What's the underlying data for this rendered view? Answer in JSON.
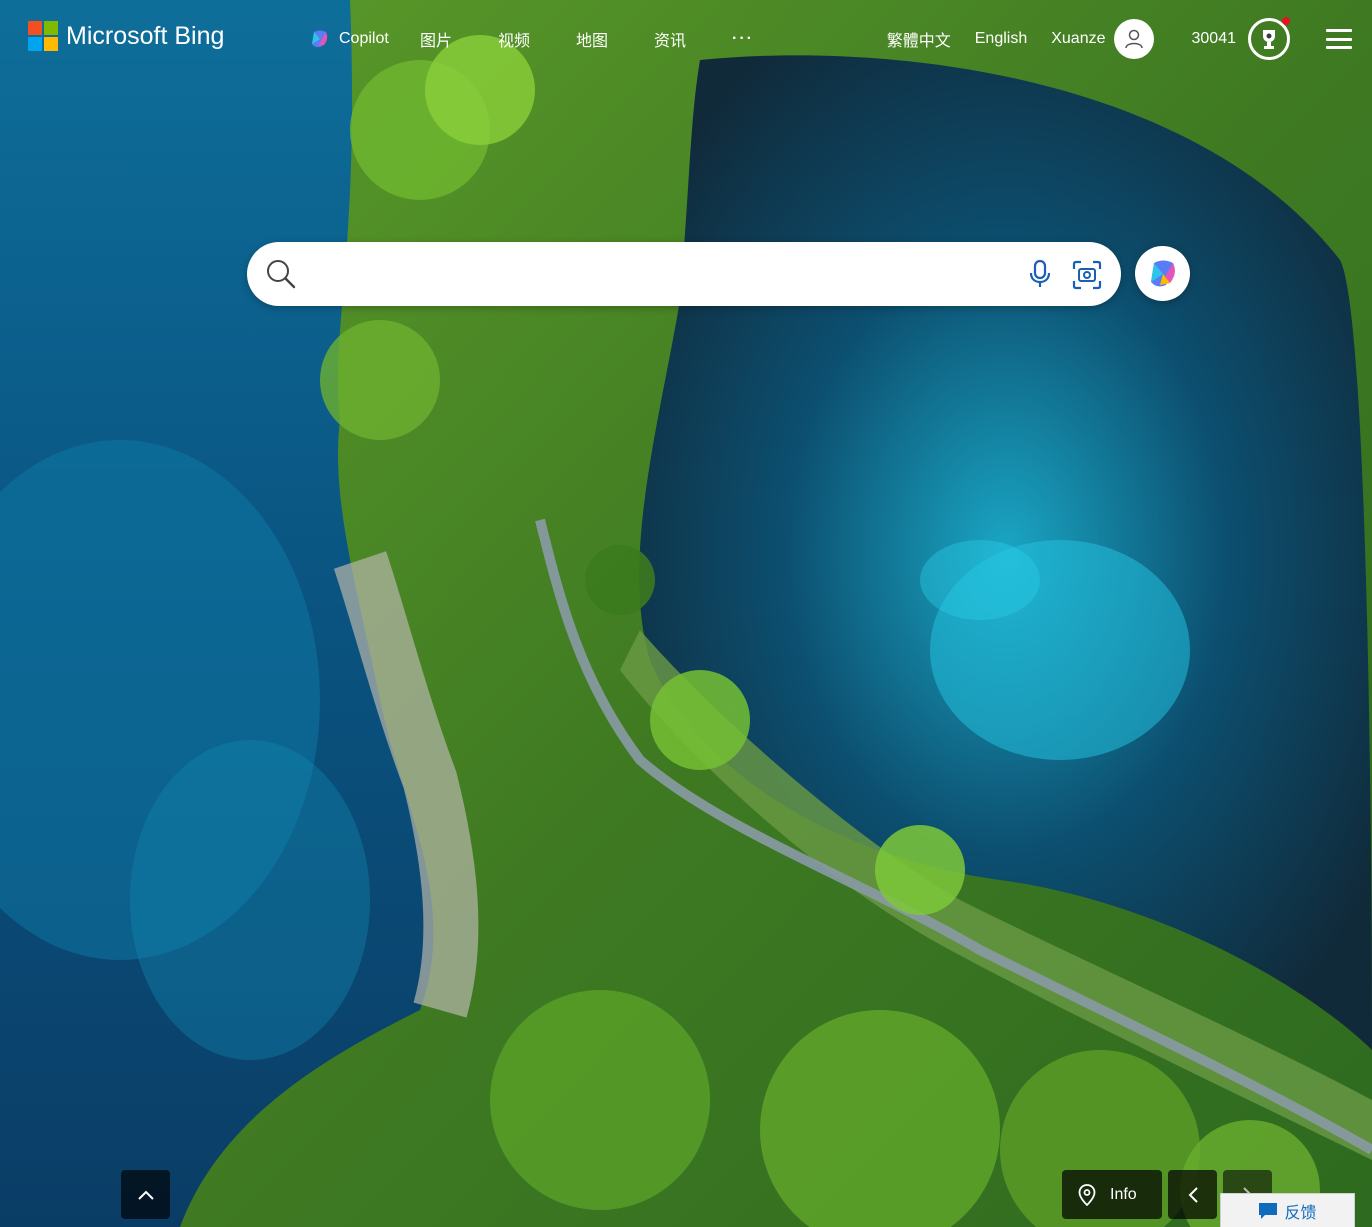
{
  "brand": {
    "name": "Microsoft Bing",
    "logo_colors": [
      "#f25022",
      "#7fba00",
      "#00a4ef",
      "#ffb900"
    ]
  },
  "nav": {
    "copilot": "Copilot",
    "images": "图片",
    "videos": "视频",
    "maps": "地图",
    "news": "资讯",
    "more": "···"
  },
  "header_right": {
    "language_traditional": "繁體中文",
    "language_english": "English",
    "username": "Xuanze",
    "reward_points": "30041"
  },
  "search": {
    "placeholder": "",
    "value": ""
  },
  "footer": {
    "info_label": "Info",
    "feedback_label": "反馈"
  },
  "icons": {
    "search": "search-icon",
    "mic": "microphone-icon",
    "visual_search": "visual-search-icon",
    "copilot": "copilot-icon",
    "avatar": "user-avatar-icon",
    "rewards": "rewards-trophy-icon",
    "menu": "hamburger-menu-icon",
    "location": "location-pin-icon",
    "up": "chevron-up-icon",
    "left": "chevron-left-icon",
    "right": "chevron-right-icon",
    "feedback": "feedback-chat-icon"
  },
  "colors": {
    "feedback_text": "#0f6cbd",
    "notification_dot": "#e81123"
  }
}
